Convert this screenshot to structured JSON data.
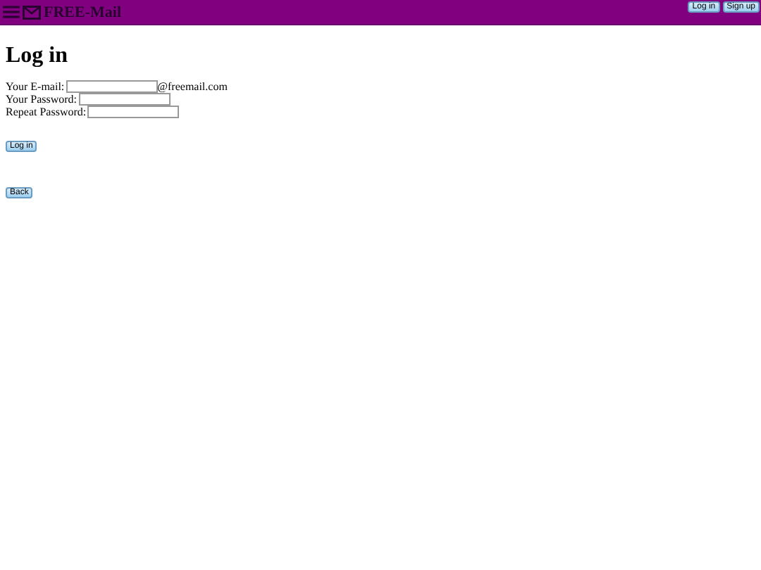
{
  "header": {
    "brand": "FREE-Mail",
    "buttons": [
      {
        "label": "Log in"
      },
      {
        "label": "Sign up"
      }
    ]
  },
  "title": "Log in",
  "fields": [
    {
      "label": "Your E-mail:",
      "suffix": "@freemail.com"
    },
    {
      "label": "Your Password:"
    },
    {
      "label": "Repeat Password:"
    }
  ],
  "submit": "Log in",
  "back": "Back"
}
